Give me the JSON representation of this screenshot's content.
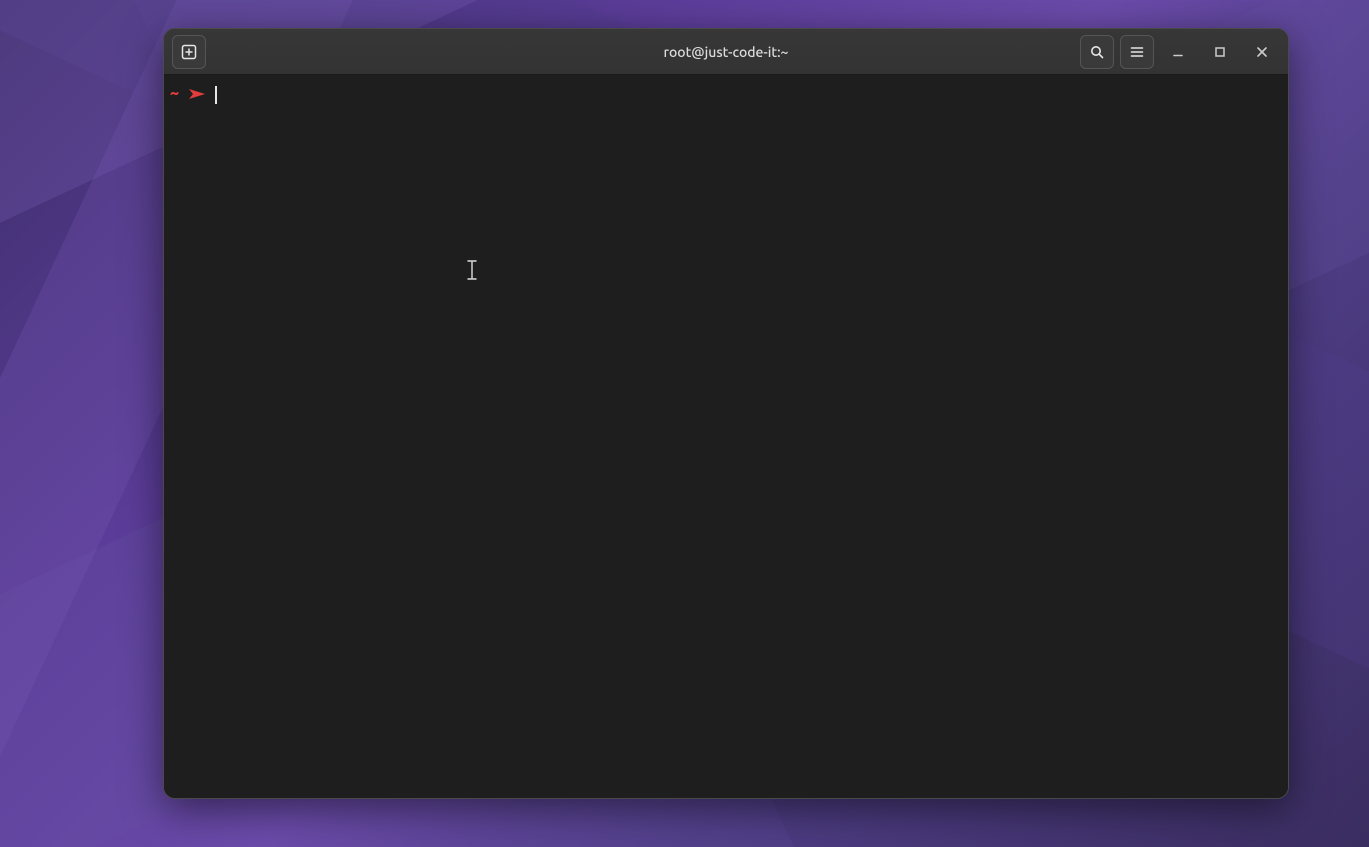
{
  "window": {
    "title": "root@just-code-it:~"
  },
  "titlebar": {
    "new_tab_icon": "new-tab-icon",
    "search_icon": "search-icon",
    "menu_icon": "hamburger-menu-icon",
    "minimize_icon": "minimize-icon",
    "maximize_icon": "maximize-icon",
    "close_icon": "close-icon"
  },
  "terminal": {
    "prompt_path": "~",
    "prompt_arrow": "➤",
    "input_value": ""
  }
}
